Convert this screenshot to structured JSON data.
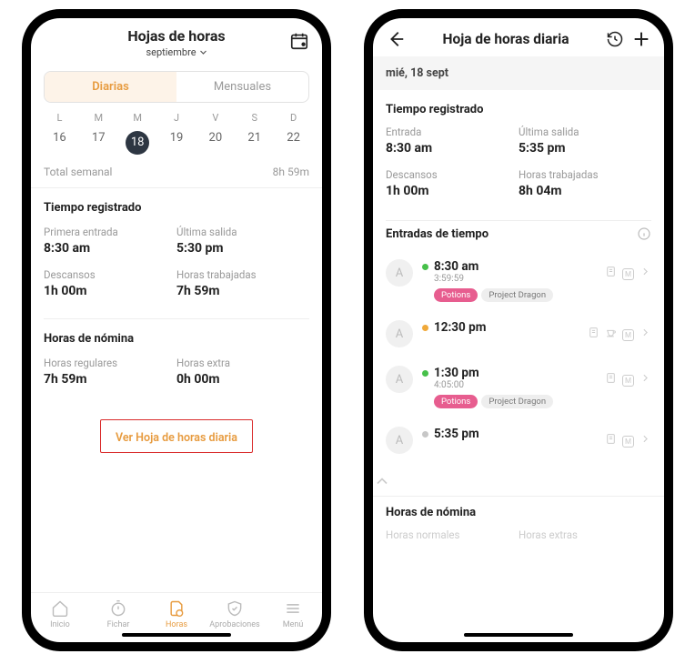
{
  "screen1": {
    "header": {
      "title": "Hojas de horas",
      "month": "septiembre"
    },
    "segments": {
      "daily": "Diarias",
      "monthly": "Mensuales"
    },
    "week": {
      "days": [
        {
          "label": "L",
          "num": "16"
        },
        {
          "label": "M",
          "num": "17"
        },
        {
          "label": "M",
          "num": "18",
          "selected": true
        },
        {
          "label": "J",
          "num": "19"
        },
        {
          "label": "V",
          "num": "20"
        },
        {
          "label": "S",
          "num": "21"
        },
        {
          "label": "D",
          "num": "22"
        }
      ]
    },
    "total": {
      "label": "Total semanal",
      "value": "8h 59m"
    },
    "time_registered": {
      "title": "Tiempo registrado",
      "first_in_label": "Primera entrada",
      "first_in_value": "8:30 am",
      "last_out_label": "Última salida",
      "last_out_value": "5:30 pm",
      "breaks_label": "Descansos",
      "breaks_value": "1h 00m",
      "worked_label": "Horas trabajadas",
      "worked_value": "7h 59m"
    },
    "payroll": {
      "title": "Horas de nómina",
      "regular_label": "Horas regulares",
      "regular_value": "7h 59m",
      "extra_label": "Horas extra",
      "extra_value": "0h 00m"
    },
    "link_text": "Ver Hoja de horas diaria",
    "tabs": {
      "home": "Inicio",
      "clock": "Fichar",
      "hours": "Horas",
      "approvals": "Aprobaciones",
      "menu": "Menú"
    }
  },
  "screen2": {
    "header": {
      "title": "Hoja de horas diaria"
    },
    "date": "mié, 18 sept",
    "time_registered": {
      "title": "Tiempo registrado",
      "in_label": "Entrada",
      "in_value": "8:30 am",
      "out_label": "Última salida",
      "out_value": "5:35 pm",
      "breaks_label": "Descansos",
      "breaks_value": "1h 00m",
      "worked_label": "Horas trabajadas",
      "worked_value": "8h 04m"
    },
    "entries_title": "Entradas de tiempo",
    "entries": [
      {
        "avatar": "A",
        "dot": "#47c04a",
        "time": "8:30 am",
        "dur": "3:59:59",
        "tags": [
          {
            "text": "Potions",
            "cls": "pink"
          },
          {
            "text": "Project Dragon",
            "cls": "grey"
          }
        ],
        "icons": [
          "note",
          "M",
          "chev"
        ]
      },
      {
        "avatar": "A",
        "dot": "#f0a93a",
        "time": "12:30 pm",
        "dur": "",
        "tags": [],
        "icons": [
          "note",
          "cup",
          "M",
          "chev"
        ]
      },
      {
        "avatar": "A",
        "dot": "#47c04a",
        "time": "1:30 pm",
        "dur": "4:05:00",
        "tags": [
          {
            "text": "Potions",
            "cls": "pink"
          },
          {
            "text": "Project Dragon",
            "cls": "grey"
          }
        ],
        "icons": [
          "note",
          "M",
          "chev"
        ]
      },
      {
        "avatar": "A",
        "dot": "#c7c7c7",
        "time": "5:35 pm",
        "dur": "",
        "tags": [],
        "icons": [
          "note",
          "M",
          "chev"
        ]
      }
    ],
    "payroll": {
      "title": "Horas de nómina",
      "normal_label": "Horas normales",
      "extra_label": "Horas extras"
    }
  }
}
